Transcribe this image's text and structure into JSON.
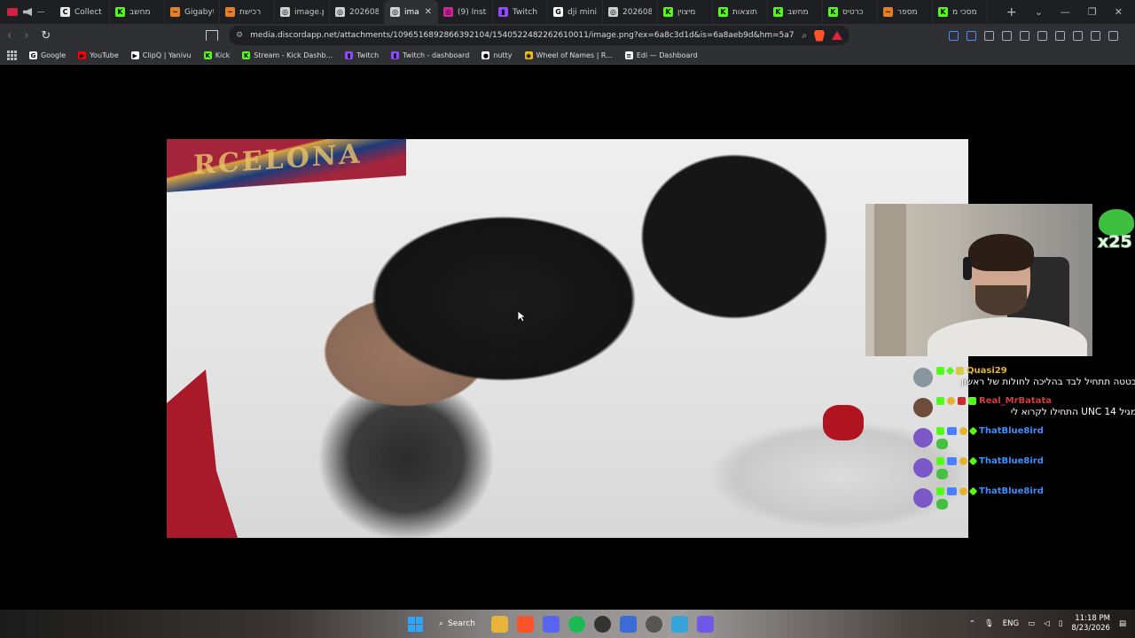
{
  "tabs": [
    {
      "label": "Collect",
      "fav": "C",
      "color": "#e8e8e8"
    },
    {
      "label": "מחשב",
      "fav": "K",
      "color": "#53fc18"
    },
    {
      "label": "Gigabyt",
      "fav": "~",
      "color": "#e67e22"
    },
    {
      "label": "רכישת",
      "fav": "~",
      "color": "#e67e22"
    },
    {
      "label": "image.p",
      "fav": "◎",
      "color": "#cfcfcf"
    },
    {
      "label": "202608",
      "fav": "◎",
      "color": "#cfcfcf"
    },
    {
      "label": "ima",
      "fav": "◎",
      "color": "#cfcfcf",
      "active": true
    },
    {
      "label": "(9) Insta",
      "fav": "◎",
      "color": "#d6249f"
    },
    {
      "label": "Twitch",
      "fav": "▮",
      "color": "#9146ff"
    },
    {
      "label": "dji mini",
      "fav": "G",
      "color": "#ffffff"
    },
    {
      "label": "202608",
      "fav": "◎",
      "color": "#cfcfcf"
    },
    {
      "label": "מיצוין",
      "fav": "K",
      "color": "#53fc18"
    },
    {
      "label": "תוצאות",
      "fav": "K",
      "color": "#53fc18"
    },
    {
      "label": "מחשב",
      "fav": "K",
      "color": "#53fc18"
    },
    {
      "label": "כרטיס",
      "fav": "K",
      "color": "#53fc18"
    },
    {
      "label": "מספר",
      "fav": "~",
      "color": "#e67e22"
    },
    {
      "label": "מסכי מ",
      "fav": "K",
      "color": "#53fc18"
    }
  ],
  "address": {
    "url": "media.discordapp.net/attachments/1096516892866392104/1540522482262610011/image.png?ex=6a8c3d1d&is=6a8aeb9d&hm=5a717da3cb2bd..."
  },
  "bookmarks": [
    {
      "label": "Google",
      "fav": "G",
      "color": "#ffffff"
    },
    {
      "label": "YouTube",
      "fav": "▶",
      "color": "#ff0000"
    },
    {
      "label": "ClipQ | Yanivu",
      "fav": "▶",
      "color": "#ffffff"
    },
    {
      "label": "Kick",
      "fav": "K",
      "color": "#53fc18"
    },
    {
      "label": "Stream - Kick Dashb...",
      "fav": "K",
      "color": "#53fc18"
    },
    {
      "label": "Twitch",
      "fav": "▮",
      "color": "#9146ff"
    },
    {
      "label": "Twitch - dashboard",
      "fav": "▮",
      "color": "#9146ff"
    },
    {
      "label": "nutty",
      "fav": "●",
      "color": "#ffffff"
    },
    {
      "label": "Wheel of Names | R...",
      "fav": "◉",
      "color": "#f1c40f"
    },
    {
      "label": "Edi — Dashboard",
      "fav": "≡",
      "color": "#ffffff"
    }
  ],
  "overlay": {
    "flag_text": "RCELONA",
    "emote_multiplier": "x25"
  },
  "chat": [
    {
      "user": "Quasi29",
      "color": "#e6b52c",
      "text": "בטטה תתחיל לבד בהליכה לחולות של ראשון",
      "avatar": "grey",
      "emote": false
    },
    {
      "user": "Real_MrBatata",
      "color": "#d63c3c",
      "text": "מגיל 14 UNC התחילו לקרוא לי",
      "avatar": "brown",
      "emote": false
    },
    {
      "user": "ThatBlue8ird",
      "color": "#3f8dff",
      "text": "",
      "avatar": "purple",
      "emote": true
    },
    {
      "user": "ThatBlue8ird",
      "color": "#3f8dff",
      "text": "",
      "avatar": "purple",
      "emote": true
    },
    {
      "user": "ThatBlue8ird",
      "color": "#3f8dff",
      "text": "",
      "avatar": "purple",
      "emote": true
    }
  ],
  "taskbar": {
    "search_label": "Search",
    "lang": "ENG",
    "time": "11:18 PM",
    "date": "8/23/2026"
  }
}
